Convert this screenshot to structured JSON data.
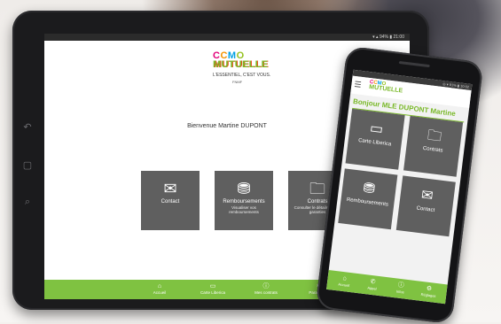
{
  "tablet": {
    "status_text": "▾ ▴ 94% ▮ 21:00",
    "logo": {
      "c1": "C",
      "c2": "C",
      "c3": "M",
      "c4": "O",
      "name": "MUTUELLE",
      "tagline": "L'ESSENTIEL, C'EST VOUS.",
      "small": "FNMF"
    },
    "welcome": "Bienvenue Martine DUPONT",
    "tiles": [
      {
        "label": "Contact",
        "sub": "",
        "icon": "envelope-icon"
      },
      {
        "label": "Remboursements",
        "sub": "Visualiser vos remboursements",
        "icon": "coins-icon"
      },
      {
        "label": "Contrats",
        "sub": "Consulter le détails de vos garanties",
        "icon": "folder-icon"
      }
    ],
    "nav": [
      {
        "label": "Accueil",
        "icon": "home-icon"
      },
      {
        "label": "Carte Liberica",
        "icon": "card-icon"
      },
      {
        "label": "Mes contrats",
        "icon": "info-icon"
      },
      {
        "label": "Paramètres",
        "icon": "gear-icon"
      }
    ]
  },
  "phone": {
    "status_text": "◎ ▾ 91% ▮ 10:02",
    "logo_name": "MUTUELLE",
    "welcome": "Bonjour MLE DUPONT Martine",
    "tiles": [
      {
        "label": "Carte Liberica",
        "icon": "card-icon"
      },
      {
        "label": "Contrats",
        "icon": "folder-icon"
      },
      {
        "label": "Remboursements",
        "icon": "coins-icon"
      },
      {
        "label": "Contact",
        "icon": "envelope-icon"
      }
    ],
    "nav": [
      {
        "label": "Accueil",
        "icon": "home-icon"
      },
      {
        "label": "Appel",
        "icon": "phone-icon"
      },
      {
        "label": "Infos",
        "icon": "info-icon"
      },
      {
        "label": "Réglages",
        "icon": "gear-icon"
      }
    ]
  }
}
